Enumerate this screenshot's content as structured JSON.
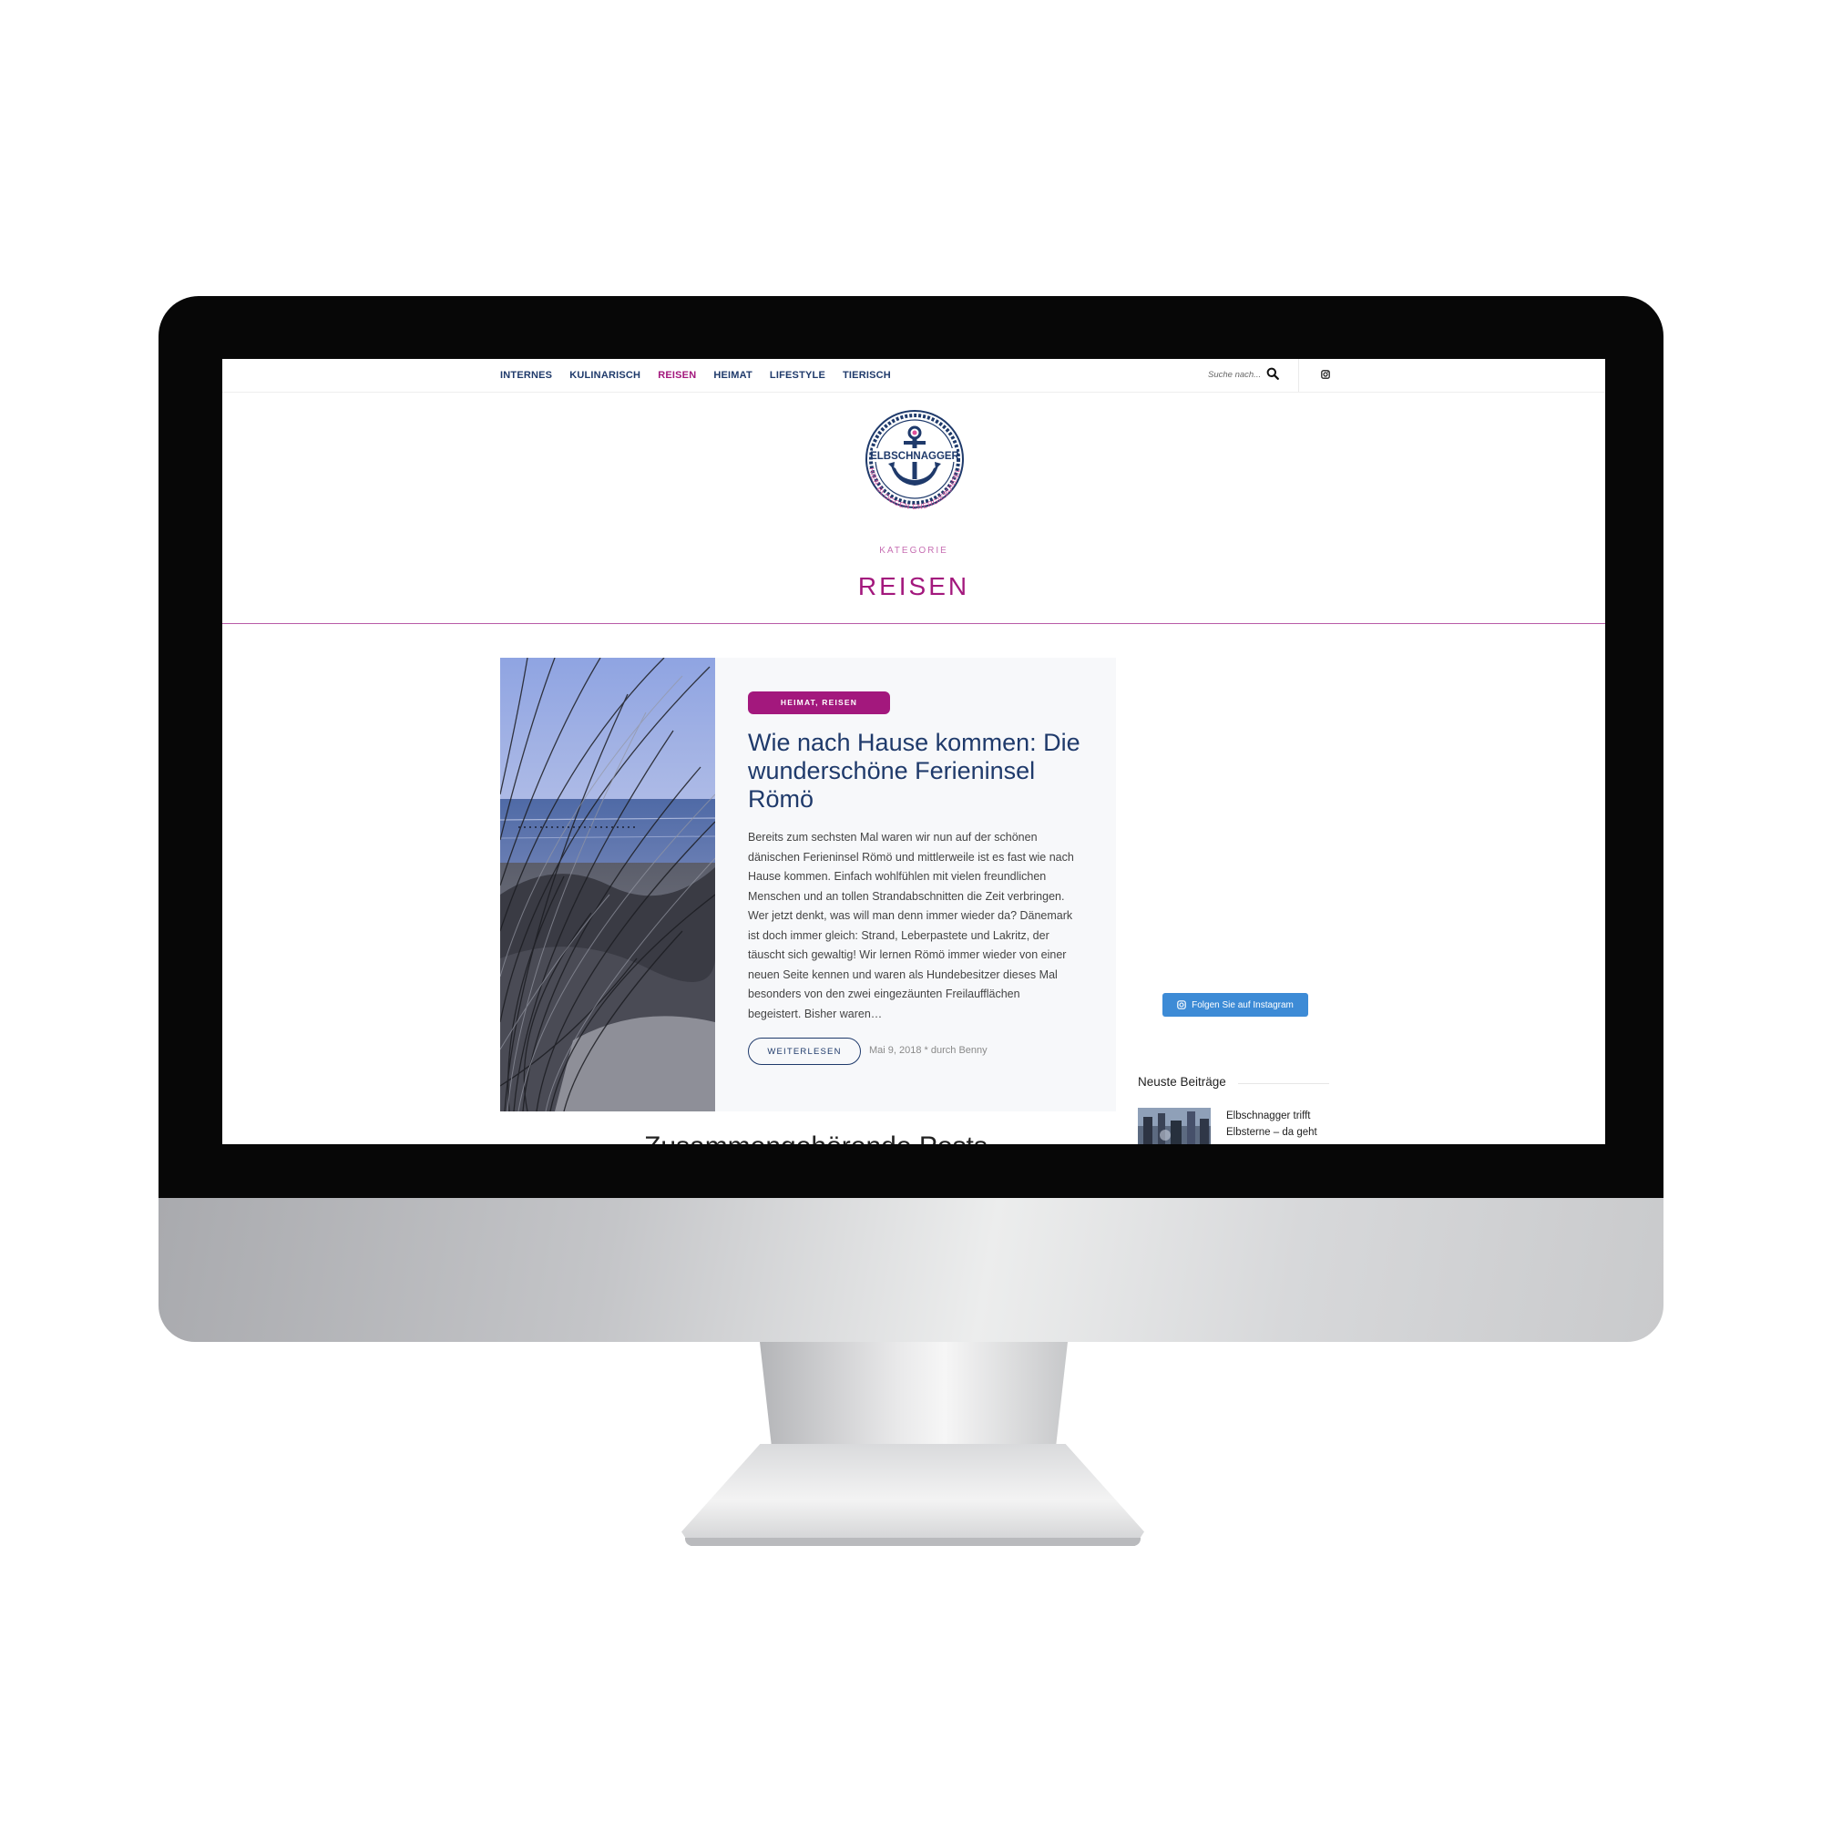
{
  "nav": {
    "items": [
      {
        "label": "INTERNES"
      },
      {
        "label": "KULINARISCH"
      },
      {
        "label": "REISEN"
      },
      {
        "label": "HEIMAT"
      },
      {
        "label": "LIFESTYLE"
      },
      {
        "label": "TIERISCH"
      }
    ],
    "active_label": "REISEN",
    "search_placeholder": "Suche nach...",
    "search_icon": "search-icon",
    "social_icon": "instagram-icon"
  },
  "logo": {
    "name": "ELBSCHNAGGER",
    "tagline": "HIER BLOGGEN ENERGIEBÜNDEL"
  },
  "category": {
    "kicker": "KATEGORIE",
    "title": "REISEN"
  },
  "post": {
    "categories": "HEIMAT, REISEN",
    "title": "Wie nach Hause kommen: Die wunderschöne Ferieninsel Römö",
    "excerpt": "Bereits zum sechsten Mal waren wir nun auf der schönen dänischen Ferieninsel Römö und mittlerweile ist es fast wie nach Hause kommen. Einfach wohlfühlen mit vielen freundlichen Menschen und an tollen Strandabschnitten die Zeit verbringen. Wer jetzt denkt, was will man denn immer wieder da? Dänemark ist doch immer gleich: Strand, Leberpastete und Lakritz, der täuscht sich gewaltig! Wir lernen Römö immer wieder von einer neuen Seite kennen und waren als Hundebesitzer dieses Mal besonders von den zwei eingezäunten Freilaufflächen begeistert. Bisher waren…",
    "read_more": "WEITERLESEN",
    "meta": "Mai 9, 2018 * durch Benny"
  },
  "next_section": {
    "heading": "Zusammengehörende Posts"
  },
  "sidebar": {
    "instagram_button": "Folgen Sie auf Instagram",
    "recent_heading": "Neuste Beiträge",
    "recent_posts": [
      {
        "title": "Elbschnagger trifft Elbsterne – da geht"
      }
    ]
  },
  "colors": {
    "brand_navy": "#1f3a6b",
    "brand_magenta": "#a3187d",
    "instagram_blue": "#3d8bd6"
  }
}
